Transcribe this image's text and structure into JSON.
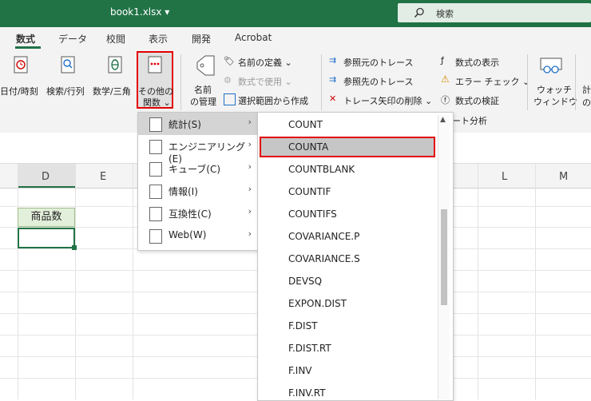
{
  "window": {
    "title": "book1.xlsx ▾",
    "search_label": "検索"
  },
  "tabs": [
    "数式",
    "データ",
    "校閲",
    "表示",
    "開発",
    "Acrobat"
  ],
  "ribbon": {
    "buttons": [
      {
        "label1": "日付/時刻",
        "label2": "",
        "icon": "calendar-clock-icon"
      },
      {
        "label1": "検索/行列",
        "label2": "",
        "icon": "lookup-book-icon"
      },
      {
        "label1": "数学/三角",
        "label2": "",
        "icon": "theta-book-icon"
      },
      {
        "label1": "その他の",
        "label2": "関数 ⌄",
        "icon": "more-functions-icon"
      }
    ],
    "name_manager": {
      "label1": "名前",
      "label2": "の管理"
    },
    "names": [
      "名前の定義 ⌄",
      "数式で使用 ⌄",
      "選択範囲から作成"
    ],
    "audit": [
      "参照元のトレース",
      "参照先のトレース",
      "トレース矢印の削除 ⌄"
    ],
    "audit2": [
      "数式の表示",
      "エラー チェック ⌄",
      "数式の検証"
    ],
    "group_label": "ート分析",
    "watch": {
      "label1": "ウォッチ",
      "label2": "ウィンドウ"
    },
    "cut_label": "計",
    "cut_label2": "の"
  },
  "grid": {
    "columns": [
      "D",
      "E",
      "L",
      "M"
    ],
    "cell_d": "商品数"
  },
  "menu1": [
    {
      "label": "統計(S)",
      "icon": "statistics-icon"
    },
    {
      "label": "エンジニアリング(E)",
      "icon": "engineering-icon"
    },
    {
      "label": "キューブ(C)",
      "icon": "cube-icon"
    },
    {
      "label": "情報(I)",
      "icon": "info-icon"
    },
    {
      "label": "互換性(C)",
      "icon": "warning-icon"
    },
    {
      "label": "Web(W)",
      "icon": "globe-icon"
    }
  ],
  "menu2": [
    "COUNT",
    "COUNTA",
    "COUNTBLANK",
    "COUNTIF",
    "COUNTIFS",
    "COVARIANCE.P",
    "COVARIANCE.S",
    "DEVSQ",
    "EXPON.DIST",
    "F.DIST",
    "F.DIST.RT",
    "F.INV",
    "F.INV.RT"
  ],
  "colors": {
    "accent": "#217346",
    "highlight": "#e30000",
    "selected": "#c6c6c6"
  }
}
